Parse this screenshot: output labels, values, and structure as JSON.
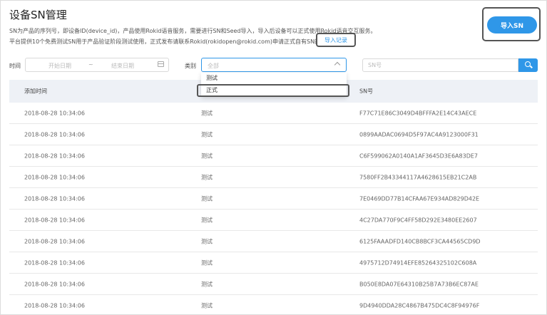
{
  "page": {
    "title": "设备SN管理",
    "desc_line1": "SN为产品的序列号，即设备ID(device_id)，产品使用Rokid语音服务，需要进行SN和Seed导入，导入后设备可以正式使用Rokid语音交互服务。",
    "desc_line2": "平台提供10个免费测试SN用于产品验证阶段测试使用，正式发布请联系Rokid(rokidopen@rokid.com)申请正式自有SN的导入。",
    "import_record_link": "导入记录",
    "import_sn_button": "导入SN"
  },
  "filters": {
    "time_label": "时间",
    "start_placeholder": "开始日期",
    "range_separator": "~",
    "end_placeholder": "结束日期",
    "category_label": "类别",
    "category_placeholder": "全部",
    "category_options": [
      "测试",
      "正式"
    ],
    "sn_placeholder": "SN号"
  },
  "table": {
    "headers": [
      "添加时间",
      "类别",
      "SN号"
    ],
    "rows": [
      [
        "2018-08-28 10:34:06",
        "测试",
        "F77C71E86C3049D4BFFFA2E14C43AECE"
      ],
      [
        "2018-08-28 10:34:06",
        "测试",
        "0899AADAC0694D5F97AC4A9123000F31"
      ],
      [
        "2018-08-28 10:34:06",
        "测试",
        "C6F599062A0140A1AF3645D3E6A83DE7"
      ],
      [
        "2018-08-28 10:34:06",
        "测试",
        "7580FF2B43344117A4628615EB21C2AB"
      ],
      [
        "2018-08-28 10:34:06",
        "测试",
        "7E0469DD77B14CFAA67E934AD829D42E"
      ],
      [
        "2018-08-28 10:34:06",
        "测试",
        "4C27DA770F9C4FF58D292E3480EE2607"
      ],
      [
        "2018-08-28 10:34:06",
        "测试",
        "6125FAAADFD140CB8BCF3CA44565CD9D"
      ],
      [
        "2018-08-28 10:34:06",
        "测试",
        "4975712D74914EFE85264325102C608A"
      ],
      [
        "2018-08-28 10:34:06",
        "测试",
        "B050E8DA07E64310B25B7A73B6EC87AE"
      ],
      [
        "2018-08-28 10:34:06",
        "测试",
        "9D4940DDA28C4867B475DC4C8F94976F"
      ]
    ]
  },
  "colors": {
    "accent": "#2f97e8",
    "header_bg": "#eef1f6"
  }
}
